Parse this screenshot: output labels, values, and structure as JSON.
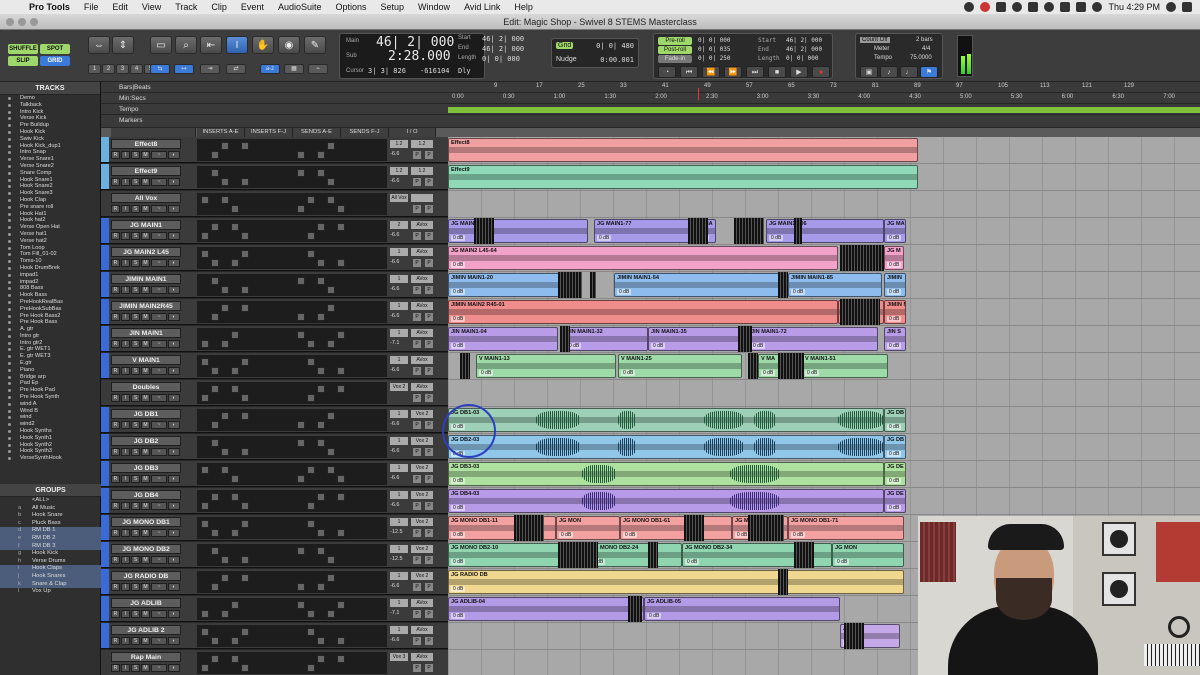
{
  "menubar": {
    "app": "Pro Tools",
    "items": [
      "File",
      "Edit",
      "View",
      "Track",
      "Clip",
      "Event",
      "AudioSuite",
      "Options",
      "Setup",
      "Window",
      "Avid Link",
      "Help"
    ],
    "time": "Thu 4:29 PM"
  },
  "window": {
    "title": "Edit: Magic Shop - Swivel 8 STEMS Masterclass"
  },
  "toolbar": {
    "modes": [
      "SHUFFLE",
      "SPOT",
      "SLIP",
      "GRID"
    ],
    "counter": {
      "main_label": "Main",
      "main_value": "46| 2| 000",
      "sub_label": "Sub",
      "sub_value": "2:28.000",
      "start_label": "Start",
      "start_value": "46| 2| 000",
      "end_label": "End",
      "end_value": "46| 2| 000",
      "length_label": "Length",
      "length_value": "0| 0| 000",
      "cursor_label": "Cursor",
      "cursor_value": "3| 3| 826",
      "cursor_extra": "-616104",
      "dly": "Dly"
    },
    "grid_label": "Grid",
    "grid_value": "0| 0| 480",
    "nudge_label": "Nudge",
    "nudge_value": "0:00.001",
    "transport": {
      "preroll": "Pre-roll",
      "preroll_value": "0| 0| 000",
      "postroll": "Post-roll",
      "postroll_value": "0| 0| 035",
      "fadein": "Fade-in",
      "fadein_value": "0| 0| 250",
      "start_label": "Start",
      "start_value": "46| 2| 000",
      "end_label": "End",
      "end_value": "46| 2| 000",
      "length_label": "Length",
      "length_value": "0| 0| 000"
    },
    "countoff": "Count Off",
    "countoff_value": "2 bars",
    "meter_label": "Meter",
    "meter_value": "4/4",
    "tempo_label": "Tempo",
    "tempo_value": "75.0000"
  },
  "tracks_panel": {
    "header": "TRACKS",
    "items": [
      "Demo",
      "Talkback",
      "Intro Kick",
      "Verse Kick",
      "Pre Buildup",
      "Hook Kick",
      "Swiv Kick",
      "Hook Kick_dup1",
      "Intro Snap",
      "Verse Snare1",
      "Verse Snare2",
      "Snare Comp",
      "Hook Snare1",
      "Hook Snare2",
      "Hook Snare3",
      "Hook Clap",
      "Pre snare roll",
      "Hook Hat1",
      "Hook hat2",
      "Verse Open Hat",
      "Verse hat1",
      "Verse hat2",
      "Tom Loop",
      "Tom Fill_01-02",
      "Toms-10",
      "Hook DrumBrek",
      "impad1",
      "impad2",
      "808 Bass",
      "Hook Bass",
      "PreHookRealBas",
      "PreHookSubBas",
      "Pre Hook Bass2",
      "Pre Hook Bass",
      "A. gtr",
      "Intro gtr",
      "Intro gtr2",
      "E. gtr WET1",
      "E. gtr WET3",
      "E.gtr",
      "Piano",
      "Bridge arp",
      "Pad Ep",
      "Pre Hook Pad",
      "Pre Hook Synth",
      "wind A",
      "Wind B",
      "wind",
      "wind2",
      "Hook Synths",
      "Hook Synth1",
      "Hook Synth2",
      "Hook Synth3",
      "VerseSynthHook"
    ],
    "groups_header": "GROUPS",
    "groups": [
      {
        "id": "",
        "name": "<ALL>",
        "sel": false
      },
      {
        "id": "a",
        "name": "All Music",
        "sel": false
      },
      {
        "id": "b",
        "name": "Hook Snare",
        "sel": false
      },
      {
        "id": "c",
        "name": "Pluck Bass",
        "sel": false
      },
      {
        "id": "d",
        "name": "RM DB 1",
        "sel": true
      },
      {
        "id": "e",
        "name": "RM DB 2",
        "sel": true
      },
      {
        "id": "f",
        "name": "RM DB 3",
        "sel": true
      },
      {
        "id": "g",
        "name": "Hook Kick",
        "sel": false
      },
      {
        "id": "h",
        "name": "Verse Drums",
        "sel": false
      },
      {
        "id": "i",
        "name": "Hook Claps",
        "sel": true
      },
      {
        "id": "j",
        "name": "Hook Snares",
        "sel": true
      },
      {
        "id": "k",
        "name": "Snare & Clap",
        "sel": true
      },
      {
        "id": "l",
        "name": "Vox Up",
        "sel": false
      }
    ]
  },
  "rulers": {
    "session_name": "Bars|Beats",
    "rows": [
      "Min:Secs",
      "Tempo",
      "Markers"
    ],
    "bars": [
      "9",
      "17",
      "25",
      "33",
      "41",
      "49",
      "57",
      "65",
      "73",
      "81",
      "89",
      "97",
      "105",
      "113",
      "121",
      "129"
    ],
    "secs": [
      "0:00",
      "0:30",
      "1:00",
      "1:30",
      "2:00",
      "2:30",
      "3:00",
      "3:30",
      "4:00",
      "4:30",
      "5:00",
      "5:30",
      "6:00",
      "6:30",
      "7:00"
    ],
    "columns": [
      "INSERTS A-E",
      "INSERTS F-J",
      "SENDS A-E",
      "SENDS F-J",
      "I / O"
    ]
  },
  "tracks": [
    {
      "name": "Effect8",
      "vol": "-6.6",
      "io": "1.2",
      "io2": "1.2",
      "color": "#6ab0e0"
    },
    {
      "name": "Effect9",
      "vol": "-6.6",
      "io": "1.2",
      "io2": "1.2",
      "color": "#6ab0e0"
    },
    {
      "name": "All Vox",
      "vol": "",
      "io": "All Vox",
      "io2": "",
      "color": "#3a3a3a"
    },
    {
      "name": "JG MAIN1",
      "vol": "-6.6",
      "io": "2",
      "io2": "AVox",
      "color": "#3a6ad8"
    },
    {
      "name": "JG MAIN2 L45",
      "vol": "-6.6",
      "io": "1",
      "io2": "AVox",
      "color": "#3a6ad8"
    },
    {
      "name": "JIMIN MAIN1",
      "vol": "-6.6",
      "io": "1",
      "io2": "AVox",
      "color": "#3a6ad8"
    },
    {
      "name": "JIMIN MAIN2R45",
      "vol": "-6.6",
      "io": "1",
      "io2": "AVox",
      "color": "#3a6ad8"
    },
    {
      "name": "JIN MAIN1",
      "vol": "-7.1",
      "io": "1",
      "io2": "AVox",
      "color": "#3a6ad8"
    },
    {
      "name": "V MAIN1",
      "vol": "-6.6",
      "io": "1",
      "io2": "AVox",
      "color": "#3a6ad8"
    },
    {
      "name": "Doubles",
      "vol": "",
      "io": "Vox 2",
      "io2": "AVox",
      "color": "#3a3a3a"
    },
    {
      "name": "JG DB1",
      "vol": "-6.6",
      "io": "1",
      "io2": "Vox 2",
      "color": "#3a6ad8"
    },
    {
      "name": "JG DB2",
      "vol": "-6.6",
      "io": "1",
      "io2": "Vox 2",
      "color": "#3a6ad8"
    },
    {
      "name": "JG DB3",
      "vol": "-6.6",
      "io": "1",
      "io2": "Vox 2",
      "color": "#3a6ad8"
    },
    {
      "name": "JG DB4",
      "vol": "-6.6",
      "io": "1",
      "io2": "Vox 2",
      "color": "#3a6ad8"
    },
    {
      "name": "JG MONO DB1",
      "vol": "-12.5",
      "io": "1",
      "io2": "Vox 2",
      "color": "#3a6ad8"
    },
    {
      "name": "JG MONO DB2",
      "vol": "-12.5",
      "io": "1",
      "io2": "Vox 2",
      "color": "#3a6ad8"
    },
    {
      "name": "JG RADIO DB",
      "vol": "-6.6",
      "io": "1",
      "io2": "Vox 2",
      "color": "#3a6ad8"
    },
    {
      "name": "JG ADLIB",
      "vol": "-7.1",
      "io": "1",
      "io2": "AVox",
      "color": "#3a6ad8"
    },
    {
      "name": "JG ADLIB 2",
      "vol": "-6.6",
      "io": "1",
      "io2": "AVox",
      "color": "#3a6ad8"
    },
    {
      "name": "Rap Main",
      "vol": "",
      "io": "Vox 3",
      "io2": "AVox",
      "color": "#3a3a3a"
    }
  ],
  "clips": {
    "effect8": "Effect8",
    "effect9": "Effect9",
    "jg_main": [
      "JG MAIN1-36",
      "JG MAIN1-77",
      "JG MA",
      "JG MAIN1-106",
      "JG MAI"
    ],
    "jg_main2": [
      "JG MAIN2 L45-64",
      "JG M"
    ],
    "jimin_main": [
      "JIMIN MAIN1-20",
      "JIMIN MAIN1-54",
      "JIMIN MAIN1-85",
      "JIMIN"
    ],
    "jimin_main2": [
      "JIMIN MAIN2 R45-01",
      "JIMIN MAIN1",
      "JIMIN M"
    ],
    "jin_main": [
      "JIN MAIN1-04",
      "JIN MAIN1-32",
      "JIN MAIN1-35",
      "JIN MAIN1-72",
      "JIN S"
    ],
    "v_main": [
      "V MAIN1-13",
      "V MAIN1-25",
      "V MA",
      "V MAIN1-51"
    ],
    "jg_db1": [
      "JG DB1-03",
      "JG DB"
    ],
    "jg_db2": [
      "JG DB2-03",
      "JG DB"
    ],
    "jg_db3": [
      "JG DB3-03",
      "JG DE"
    ],
    "jg_db4": [
      "JG DB4-03",
      "JG DE"
    ],
    "jg_mono1": [
      "JG MONO DB1-11",
      "JG MON",
      "JG MONO DB1-61",
      "JG MON",
      "JG MONO DB1-71"
    ],
    "jg_mono2": [
      "JG MONO DB2-10",
      "JG MONO DB2-24",
      "JG MONO DB2-34",
      "JG MON"
    ],
    "jg_radio": "JG RADIO DB",
    "jg_adlib": [
      "JG ADLIB-04",
      "JG ADLIB-05"
    ],
    "jg_adlib2": "JG A",
    "gain": "0 dB",
    "gain_alt": "-12.0"
  }
}
